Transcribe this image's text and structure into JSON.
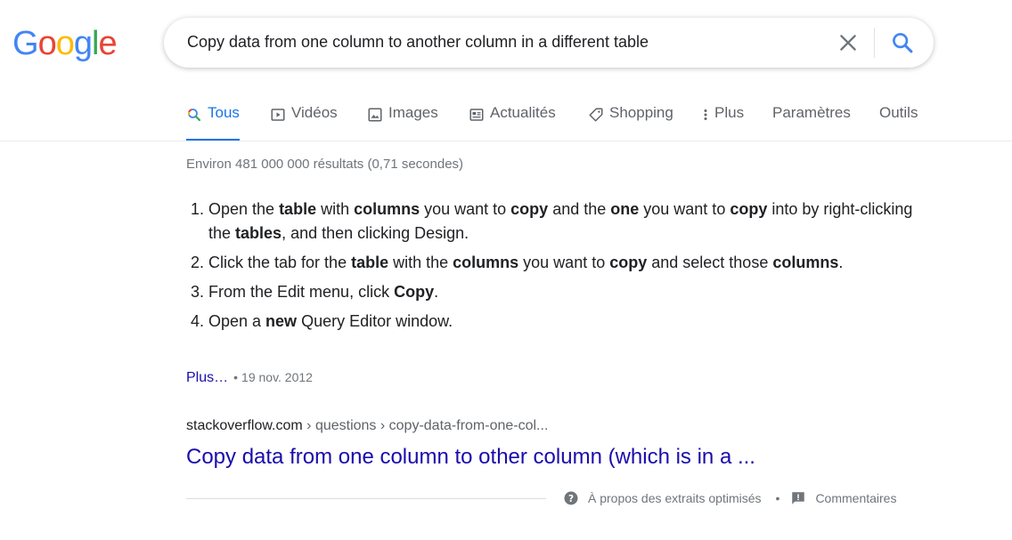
{
  "logo": {
    "letters": [
      "G",
      "o",
      "o",
      "g",
      "l",
      "e"
    ],
    "colors": [
      "#4285f4",
      "#ea4335",
      "#fbbc05",
      "#4285f4",
      "#34a853",
      "#ea4335"
    ]
  },
  "search": {
    "query": "Copy data from one column to another column in a different table"
  },
  "tabs": [
    {
      "label": "Tous",
      "icon": "search-icon",
      "active": true
    },
    {
      "label": "Vidéos",
      "icon": "video-icon"
    },
    {
      "label": "Images",
      "icon": "image-icon"
    },
    {
      "label": "Actualités",
      "icon": "news-icon"
    },
    {
      "label": "Shopping",
      "icon": "tag-icon"
    },
    {
      "label": "Plus",
      "icon": "more-vert-icon"
    },
    {
      "label": "Paramètres"
    },
    {
      "label": "Outils"
    }
  ],
  "stats": "Environ 481 000 000 résultats (0,71 secondes)",
  "snippet": {
    "steps": [
      [
        [
          "Open the ",
          false
        ],
        [
          "table",
          true
        ],
        [
          " with ",
          false
        ],
        [
          "columns",
          true
        ],
        [
          " you want to ",
          false
        ],
        [
          "copy",
          true
        ],
        [
          " and the ",
          false
        ],
        [
          "one",
          true
        ],
        [
          " you want to ",
          false
        ],
        [
          "copy",
          true
        ],
        [
          " into by right-clicking the ",
          false
        ],
        [
          "tables",
          true
        ],
        [
          ", and then clicking Design.",
          false
        ]
      ],
      [
        [
          "Click the tab for the ",
          false
        ],
        [
          "table",
          true
        ],
        [
          " with the ",
          false
        ],
        [
          "columns",
          true
        ],
        [
          " you want to ",
          false
        ],
        [
          "copy",
          true
        ],
        [
          " and select those ",
          false
        ],
        [
          "columns",
          true
        ],
        [
          ".",
          false
        ]
      ],
      [
        [
          "From the Edit menu, click ",
          false
        ],
        [
          "Copy",
          true
        ],
        [
          ".",
          false
        ]
      ],
      [
        [
          "Open a ",
          false
        ],
        [
          "new",
          true
        ],
        [
          " Query Editor window.",
          false
        ]
      ]
    ],
    "more_label": "Plus…",
    "date": "19 nov. 2012"
  },
  "result": {
    "domain": "stackoverflow.com",
    "path": " › questions › copy-data-from-one-col...",
    "title": "Copy data from one column to other column (which is in a ..."
  },
  "footer": {
    "about_label": "À propos des extraits optimisés",
    "feedback_label": "Commentaires"
  },
  "colors": {
    "accent": "#1a73e8",
    "link": "#1a0dab",
    "muted": "#70757a"
  }
}
